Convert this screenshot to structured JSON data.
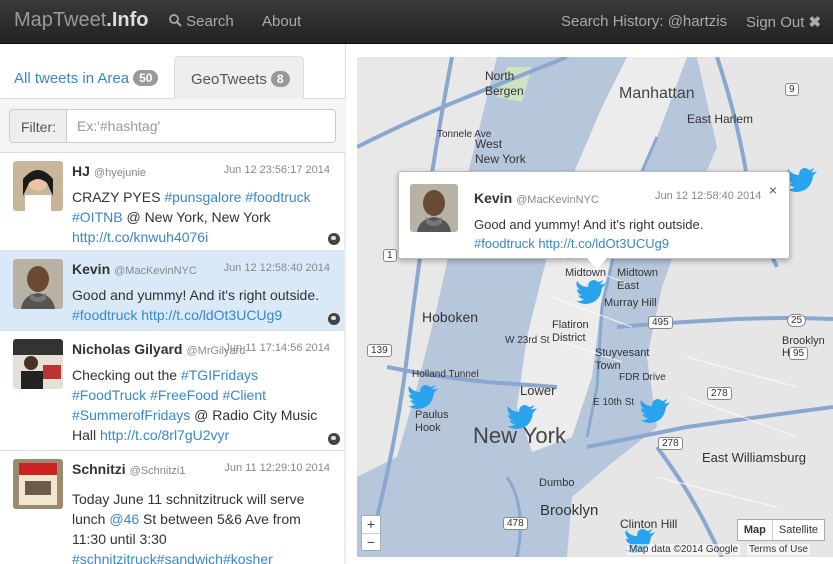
{
  "navbar": {
    "brand_main": "MapTweet",
    "brand_suffix": ".Info",
    "search_label": "Search",
    "about_label": "About",
    "history_label": "Search History: @hartzis",
    "signout_label": "Sign Out"
  },
  "tabs": [
    {
      "label": "All tweets in Area",
      "count": "50"
    },
    {
      "label": "GeoTweets",
      "count": "8"
    }
  ],
  "filter": {
    "label": "Filter:",
    "placeholder": "Ex:'#hashtag'"
  },
  "tweets": [
    {
      "name": "HJ",
      "handle": "@hyejunie",
      "date": "Jun 12 23:56:17 2014",
      "text_plain": "CRAZY PYES ",
      "text_tags": "#punsgalore #foodtruck #OITNB",
      "text_after": " @ New York, New York",
      "link": "http://t.co/knwuh4076i"
    },
    {
      "name": "Kevin",
      "handle": "@MacKevinNYC",
      "date": "Jun 12 12:58:40 2014",
      "text_plain": "Good and yummy! And it's right outside.",
      "text_tags": "#foodtruck",
      "link": "http://t.co/ldOt3UCUg9"
    },
    {
      "name": "Nicholas Gilyard",
      "handle": "@MrGilyard",
      "date": "Jun 11 17:14:56 2014",
      "text_plain": "Checking out the ",
      "text_tags": "#TGIFridays #FoodTruck #FreeFood #Client #SummerofFridays",
      "text_after": " @ Radio City Music Hall",
      "link": "http://t.co/8rl7gU2vyr"
    },
    {
      "name": "Schnitzi",
      "handle": "@Schnitzi1",
      "date": "Jun 11 12:29:10 2014",
      "text_plain": "Today June 11 schnitzitruck will serve lunch ",
      "mention": "@46",
      "text_after": " St between 5&6 Ave from 11:30 until 3:30",
      "text_tags": "#schnitzitruck#sandwich#kosher"
    }
  ],
  "popup": {
    "name": "Kevin",
    "handle": "@MacKevinNYC",
    "date": "Jun 12 12:58:40 2014",
    "text": "Good and yummy! And it's right outside.",
    "tag": "#foodtruck",
    "link": "http://t.co/ldOt3UCUg9",
    "close": "×"
  },
  "map": {
    "labels": {
      "north_bergen": "North\nBergen",
      "west_ny": "West\nNew York",
      "manhattan": "Manhattan",
      "east_harlem": "East Harlem",
      "hoboken": "Hoboken",
      "midtown": "Midtown",
      "midtown_east": "Midtown\nEast",
      "murray_hill": "Murray Hill",
      "flatiron": "Flatiron\nDistrict",
      "stuyvesant": "Stuyvesant\nTown",
      "lower_manhattan": "Lower",
      "new_york": "New York",
      "paulus_hook": "Paulus\nHook",
      "east_williamsburg": "East Williamsburg",
      "dumbo": "Dumbo",
      "brooklyn": "Brooklyn",
      "clinton_hill": "Clinton Hill",
      "brooklyn_heights": "Brooklyn He",
      "holland_tunnel": "Holland Tunnel",
      "fdr": "FDR Drive",
      "tonnele": "Tonnele Ave",
      "e10": "E 10th St",
      "w23": "W 23rd St"
    },
    "shields": [
      "9",
      "495",
      "278",
      "478",
      "278",
      "1",
      "139",
      "25",
      "95"
    ],
    "zoom_in": "+",
    "zoom_out": "−",
    "type_map": "Map",
    "type_satellite": "Satellite",
    "attribution": "Map data ©2014 Google",
    "terms": "Terms of Use"
  },
  "colors": {
    "link": "#3a87c8",
    "selected_row": "#d9e9f7",
    "twitter_blue": "#2aa3ef",
    "map_water": "#b7c7db",
    "map_land": "#e8e8e8"
  }
}
